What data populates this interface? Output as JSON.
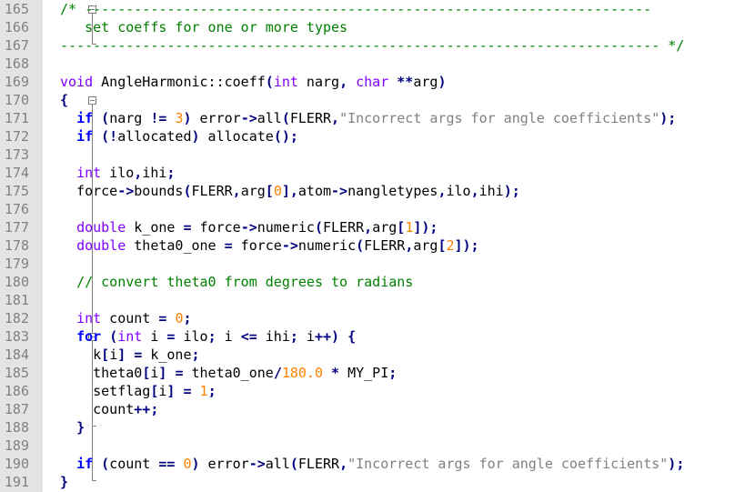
{
  "colors": {
    "gutter_bg": "#e4e4e4",
    "line_number": "#808080",
    "comment": "#008000",
    "type_keyword": "#8000ff",
    "control_keyword": "#0000ff",
    "operator": "#000080",
    "number": "#ff8000",
    "string": "#808080",
    "text": "#000000"
  },
  "editor": {
    "lines": [
      {
        "num": "165",
        "segments": [
          {
            "c": "cm",
            "t": "/* ---------------------------------------------------------------------"
          }
        ]
      },
      {
        "num": "166",
        "segments": [
          {
            "c": "cm",
            "t": "   set coeffs for one or more types"
          }
        ]
      },
      {
        "num": "167",
        "segments": [
          {
            "c": "cm",
            "t": "------------------------------------------------------------------------- */"
          }
        ]
      },
      {
        "num": "168",
        "segments": []
      },
      {
        "num": "169",
        "segments": [
          {
            "c": "kw",
            "t": "void"
          },
          {
            "c": "tx",
            "t": " AngleHarmonic::coeff"
          },
          {
            "c": "op",
            "t": "("
          },
          {
            "c": "kw",
            "t": "int"
          },
          {
            "c": "tx",
            "t": " narg"
          },
          {
            "c": "op",
            "t": ","
          },
          {
            "c": "tx",
            "t": " "
          },
          {
            "c": "kw",
            "t": "char"
          },
          {
            "c": "tx",
            "t": " "
          },
          {
            "c": "op",
            "t": "**"
          },
          {
            "c": "tx",
            "t": "arg"
          },
          {
            "c": "op",
            "t": ")"
          }
        ]
      },
      {
        "num": "170",
        "segments": [
          {
            "c": "op",
            "t": "{"
          }
        ]
      },
      {
        "num": "171",
        "segments": [
          {
            "c": "tx",
            "t": "  "
          },
          {
            "c": "kb",
            "t": "if"
          },
          {
            "c": "tx",
            "t": " "
          },
          {
            "c": "op",
            "t": "("
          },
          {
            "c": "tx",
            "t": "narg "
          },
          {
            "c": "op",
            "t": "!="
          },
          {
            "c": "tx",
            "t": " "
          },
          {
            "c": "nm",
            "t": "3"
          },
          {
            "c": "op",
            "t": ")"
          },
          {
            "c": "tx",
            "t": " error"
          },
          {
            "c": "op",
            "t": "->"
          },
          {
            "c": "tx",
            "t": "all"
          },
          {
            "c": "op",
            "t": "("
          },
          {
            "c": "tx",
            "t": "FLERR"
          },
          {
            "c": "op",
            "t": ","
          },
          {
            "c": "st",
            "t": "\"Incorrect args for angle coefficients\""
          },
          {
            "c": "op",
            "t": ");"
          }
        ]
      },
      {
        "num": "172",
        "segments": [
          {
            "c": "tx",
            "t": "  "
          },
          {
            "c": "kb",
            "t": "if"
          },
          {
            "c": "tx",
            "t": " "
          },
          {
            "c": "op",
            "t": "(!"
          },
          {
            "c": "tx",
            "t": "allocated"
          },
          {
            "c": "op",
            "t": ")"
          },
          {
            "c": "tx",
            "t": " allocate"
          },
          {
            "c": "op",
            "t": "();"
          }
        ]
      },
      {
        "num": "173",
        "segments": []
      },
      {
        "num": "174",
        "segments": [
          {
            "c": "tx",
            "t": "  "
          },
          {
            "c": "kw",
            "t": "int"
          },
          {
            "c": "tx",
            "t": " ilo"
          },
          {
            "c": "op",
            "t": ","
          },
          {
            "c": "tx",
            "t": "ihi"
          },
          {
            "c": "op",
            "t": ";"
          }
        ]
      },
      {
        "num": "175",
        "segments": [
          {
            "c": "tx",
            "t": "  force"
          },
          {
            "c": "op",
            "t": "->"
          },
          {
            "c": "tx",
            "t": "bounds"
          },
          {
            "c": "op",
            "t": "("
          },
          {
            "c": "tx",
            "t": "FLERR"
          },
          {
            "c": "op",
            "t": ","
          },
          {
            "c": "tx",
            "t": "arg"
          },
          {
            "c": "op",
            "t": "["
          },
          {
            "c": "nm",
            "t": "0"
          },
          {
            "c": "op",
            "t": "],"
          },
          {
            "c": "tx",
            "t": "atom"
          },
          {
            "c": "op",
            "t": "->"
          },
          {
            "c": "tx",
            "t": "nangletypes"
          },
          {
            "c": "op",
            "t": ","
          },
          {
            "c": "tx",
            "t": "ilo"
          },
          {
            "c": "op",
            "t": ","
          },
          {
            "c": "tx",
            "t": "ihi"
          },
          {
            "c": "op",
            "t": ");"
          }
        ]
      },
      {
        "num": "176",
        "segments": []
      },
      {
        "num": "177",
        "segments": [
          {
            "c": "tx",
            "t": "  "
          },
          {
            "c": "kw",
            "t": "double"
          },
          {
            "c": "tx",
            "t": " k_one "
          },
          {
            "c": "op",
            "t": "="
          },
          {
            "c": "tx",
            "t": " force"
          },
          {
            "c": "op",
            "t": "->"
          },
          {
            "c": "tx",
            "t": "numeric"
          },
          {
            "c": "op",
            "t": "("
          },
          {
            "c": "tx",
            "t": "FLERR"
          },
          {
            "c": "op",
            "t": ","
          },
          {
            "c": "tx",
            "t": "arg"
          },
          {
            "c": "op",
            "t": "["
          },
          {
            "c": "nm",
            "t": "1"
          },
          {
            "c": "op",
            "t": "]);"
          }
        ]
      },
      {
        "num": "178",
        "segments": [
          {
            "c": "tx",
            "t": "  "
          },
          {
            "c": "kw",
            "t": "double"
          },
          {
            "c": "tx",
            "t": " theta0_one "
          },
          {
            "c": "op",
            "t": "="
          },
          {
            "c": "tx",
            "t": " force"
          },
          {
            "c": "op",
            "t": "->"
          },
          {
            "c": "tx",
            "t": "numeric"
          },
          {
            "c": "op",
            "t": "("
          },
          {
            "c": "tx",
            "t": "FLERR"
          },
          {
            "c": "op",
            "t": ","
          },
          {
            "c": "tx",
            "t": "arg"
          },
          {
            "c": "op",
            "t": "["
          },
          {
            "c": "nm",
            "t": "2"
          },
          {
            "c": "op",
            "t": "]);"
          }
        ]
      },
      {
        "num": "179",
        "segments": []
      },
      {
        "num": "180",
        "segments": [
          {
            "c": "tx",
            "t": "  "
          },
          {
            "c": "cm",
            "t": "// convert theta0 from degrees to radians"
          }
        ]
      },
      {
        "num": "181",
        "segments": []
      },
      {
        "num": "182",
        "segments": [
          {
            "c": "tx",
            "t": "  "
          },
          {
            "c": "kw",
            "t": "int"
          },
          {
            "c": "tx",
            "t": " count "
          },
          {
            "c": "op",
            "t": "="
          },
          {
            "c": "tx",
            "t": " "
          },
          {
            "c": "nm",
            "t": "0"
          },
          {
            "c": "op",
            "t": ";"
          }
        ]
      },
      {
        "num": "183",
        "segments": [
          {
            "c": "tx",
            "t": "  "
          },
          {
            "c": "kb",
            "t": "for"
          },
          {
            "c": "tx",
            "t": " "
          },
          {
            "c": "op",
            "t": "("
          },
          {
            "c": "kw",
            "t": "int"
          },
          {
            "c": "tx",
            "t": " i "
          },
          {
            "c": "op",
            "t": "="
          },
          {
            "c": "tx",
            "t": " ilo"
          },
          {
            "c": "op",
            "t": ";"
          },
          {
            "c": "tx",
            "t": " i "
          },
          {
            "c": "op",
            "t": "<="
          },
          {
            "c": "tx",
            "t": " ihi"
          },
          {
            "c": "op",
            "t": ";"
          },
          {
            "c": "tx",
            "t": " i"
          },
          {
            "c": "op",
            "t": "++)"
          },
          {
            "c": "tx",
            "t": " "
          },
          {
            "c": "op",
            "t": "{"
          }
        ]
      },
      {
        "num": "184",
        "segments": [
          {
            "c": "tx",
            "t": "    k"
          },
          {
            "c": "op",
            "t": "["
          },
          {
            "c": "tx",
            "t": "i"
          },
          {
            "c": "op",
            "t": "]"
          },
          {
            "c": "tx",
            "t": " "
          },
          {
            "c": "op",
            "t": "="
          },
          {
            "c": "tx",
            "t": " k_one"
          },
          {
            "c": "op",
            "t": ";"
          }
        ]
      },
      {
        "num": "185",
        "segments": [
          {
            "c": "tx",
            "t": "    theta0"
          },
          {
            "c": "op",
            "t": "["
          },
          {
            "c": "tx",
            "t": "i"
          },
          {
            "c": "op",
            "t": "]"
          },
          {
            "c": "tx",
            "t": " "
          },
          {
            "c": "op",
            "t": "="
          },
          {
            "c": "tx",
            "t": " theta0_one"
          },
          {
            "c": "op",
            "t": "/"
          },
          {
            "c": "nm",
            "t": "180.0"
          },
          {
            "c": "tx",
            "t": " "
          },
          {
            "c": "op",
            "t": "*"
          },
          {
            "c": "tx",
            "t": " MY_PI"
          },
          {
            "c": "op",
            "t": ";"
          }
        ]
      },
      {
        "num": "186",
        "segments": [
          {
            "c": "tx",
            "t": "    setflag"
          },
          {
            "c": "op",
            "t": "["
          },
          {
            "c": "tx",
            "t": "i"
          },
          {
            "c": "op",
            "t": "]"
          },
          {
            "c": "tx",
            "t": " "
          },
          {
            "c": "op",
            "t": "="
          },
          {
            "c": "tx",
            "t": " "
          },
          {
            "c": "nm",
            "t": "1"
          },
          {
            "c": "op",
            "t": ";"
          }
        ]
      },
      {
        "num": "187",
        "segments": [
          {
            "c": "tx",
            "t": "    count"
          },
          {
            "c": "op",
            "t": "++;"
          }
        ]
      },
      {
        "num": "188",
        "segments": [
          {
            "c": "tx",
            "t": "  "
          },
          {
            "c": "op",
            "t": "}"
          }
        ]
      },
      {
        "num": "189",
        "segments": []
      },
      {
        "num": "190",
        "segments": [
          {
            "c": "tx",
            "t": "  "
          },
          {
            "c": "kb",
            "t": "if"
          },
          {
            "c": "tx",
            "t": " "
          },
          {
            "c": "op",
            "t": "("
          },
          {
            "c": "tx",
            "t": "count "
          },
          {
            "c": "op",
            "t": "=="
          },
          {
            "c": "tx",
            "t": " "
          },
          {
            "c": "nm",
            "t": "0"
          },
          {
            "c": "op",
            "t": ")"
          },
          {
            "c": "tx",
            "t": " error"
          },
          {
            "c": "op",
            "t": "->"
          },
          {
            "c": "tx",
            "t": "all"
          },
          {
            "c": "op",
            "t": "("
          },
          {
            "c": "tx",
            "t": "FLERR"
          },
          {
            "c": "op",
            "t": ","
          },
          {
            "c": "st",
            "t": "\"Incorrect args for angle coefficients\""
          },
          {
            "c": "op",
            "t": ");"
          }
        ]
      },
      {
        "num": "191",
        "segments": [
          {
            "c": "op",
            "t": "}"
          }
        ]
      }
    ]
  }
}
